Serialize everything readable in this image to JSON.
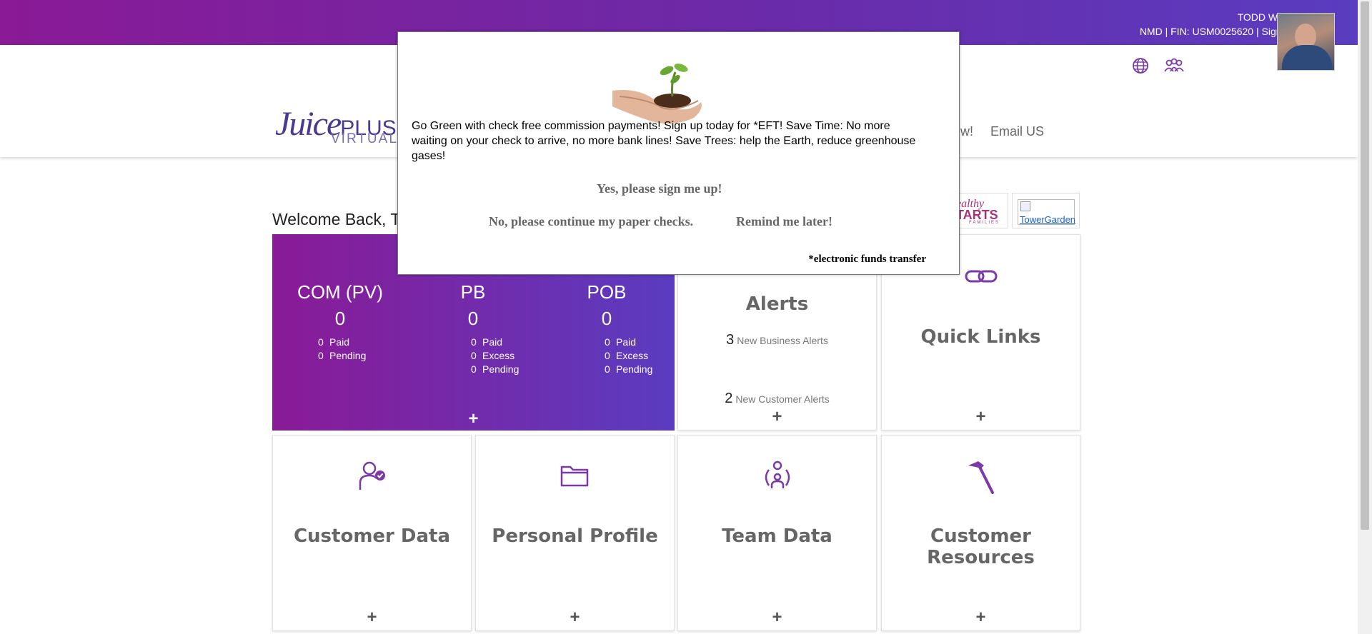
{
  "header": {
    "user_name": "TODD WHITE",
    "rank": "NMD",
    "fin_label": "FIN:",
    "fin_value": "USM0025620",
    "separator": "|",
    "sign_out": "Sign Out",
    "icons": [
      "globe-icon",
      "team-icon"
    ]
  },
  "logo": {
    "word": "Juice",
    "plus": "PLUS",
    "subtitle": "VIRTUAL OFFICE"
  },
  "nav": {
    "partial_link": "ew!",
    "email_link": "Email US"
  },
  "welcome": "Welcome Back, T",
  "partners": {
    "healthy_starts_line1": "ealthy",
    "healthy_starts_line2": "TARTS",
    "healthy_starts_line3": "FAMILIES",
    "tower_garden": "TowerGarden"
  },
  "commission": {
    "columns": [
      {
        "title": "COM (PV)",
        "value": "0",
        "rows": [
          {
            "n": "0",
            "label": "Paid"
          },
          {
            "n": "0",
            "label": "Pending"
          }
        ]
      },
      {
        "title": "PB",
        "value": "0",
        "rows": [
          {
            "n": "0",
            "label": "Paid"
          },
          {
            "n": "0",
            "label": "Excess"
          },
          {
            "n": "0",
            "label": "Pending"
          }
        ]
      },
      {
        "title": "POB",
        "value": "0",
        "rows": [
          {
            "n": "0",
            "label": "Paid"
          },
          {
            "n": "0",
            "label": "Excess"
          },
          {
            "n": "0",
            "label": "Pending"
          }
        ]
      }
    ],
    "expand": "+"
  },
  "alerts": {
    "title": "Alerts",
    "business_count": "3",
    "business_label": "New Business Alerts",
    "customer_count": "2",
    "customer_label": "New Customer Alerts",
    "expand": "+"
  },
  "tiles": {
    "quick_links": "Quick Links",
    "customer_data": "Customer Data",
    "personal_profile": "Personal Profile",
    "team_data": "Team Data",
    "customer_resources": "Customer Resources",
    "expand": "+"
  },
  "modal": {
    "message": "Go Green with check free commission payments! Sign up today for *EFT! Save Time: No more waiting on your check to arrive, no more bank lines! Save Trees: help the Earth, reduce greenhouse gases!",
    "yes_option": "Yes, please sign me up!",
    "no_option": "No, please continue my paper checks.",
    "remind_option": "Remind me later!",
    "footnote": "*electronic funds transfer"
  },
  "colors": {
    "gradient_start": "#8a1a96",
    "gradient_end": "#5a3cc0",
    "icon_purple": "#7b3aa8"
  }
}
